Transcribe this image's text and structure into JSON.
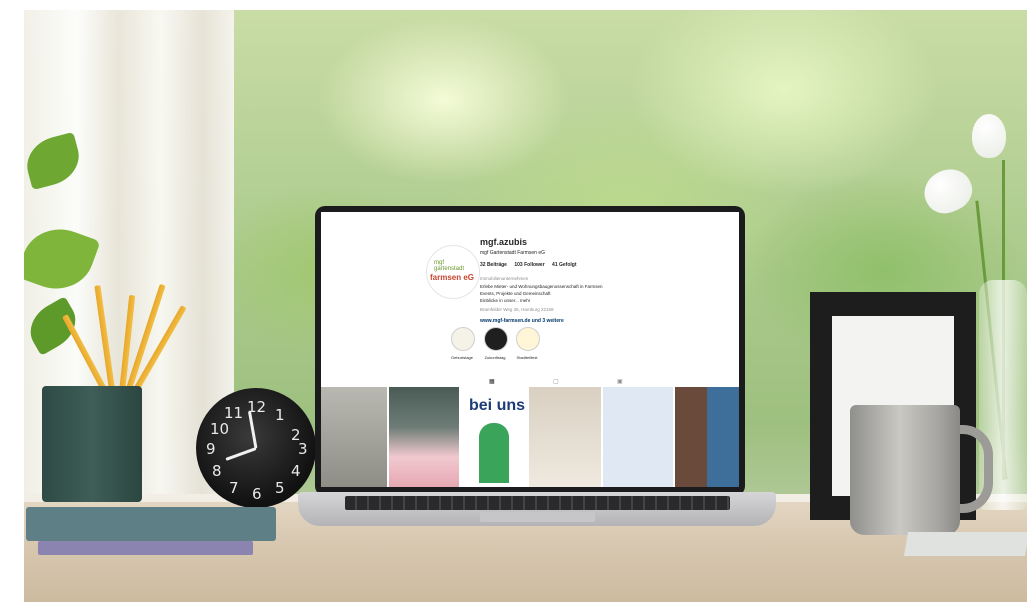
{
  "profile": {
    "username": "mgf.azubis",
    "subtitle": "mgf Gartenstadt Farmsen eG",
    "stats": [
      "32 Beiträge",
      "103 Follower",
      "41 Gefolgt"
    ],
    "category": "Immobilienunternehmen",
    "bio_lines": [
      "Erlebe Mieter- und Wohnungsbaugenossenschaft in Farmsen",
      "Events, Projekte und Gemeinschaft",
      "Einblicke in unser... mehr",
      "Bramfelder Weg 35, Hamburg 22159"
    ],
    "link": "www.mgf-farmsen.de und 3 weitere",
    "avatar_logo": {
      "line1": "mgf",
      "line2": "gartenstadt",
      "line3": "farmsen eG"
    }
  },
  "highlights": [
    {
      "label": "Geburtstage",
      "icon": "cake-icon"
    },
    {
      "label": "Zukunftstag",
      "icon": "head-icon"
    },
    {
      "label": "Stadtteilfest",
      "icon": "sun-icon"
    }
  ],
  "tabs": [
    {
      "icon": "grid-icon"
    },
    {
      "icon": "reels-icon"
    },
    {
      "icon": "tagged-icon"
    }
  ],
  "posts": [
    {
      "name": "post-office-screen"
    },
    {
      "name": "post-birthday-table"
    },
    {
      "name": "post-magazine-cover",
      "text": "bei uns"
    },
    {
      "name": "post-desk-papers"
    },
    {
      "name": "post-building-flyer"
    },
    {
      "name": "post-building-collage"
    }
  ],
  "clock": {
    "numbers": [
      "12",
      "1",
      "2",
      "3",
      "4",
      "5",
      "6",
      "7",
      "8",
      "9",
      "10",
      "11"
    ]
  },
  "colors": {
    "brand_green": "#6b9a2e",
    "brand_red": "#c8442f",
    "link_blue": "#00376b"
  }
}
